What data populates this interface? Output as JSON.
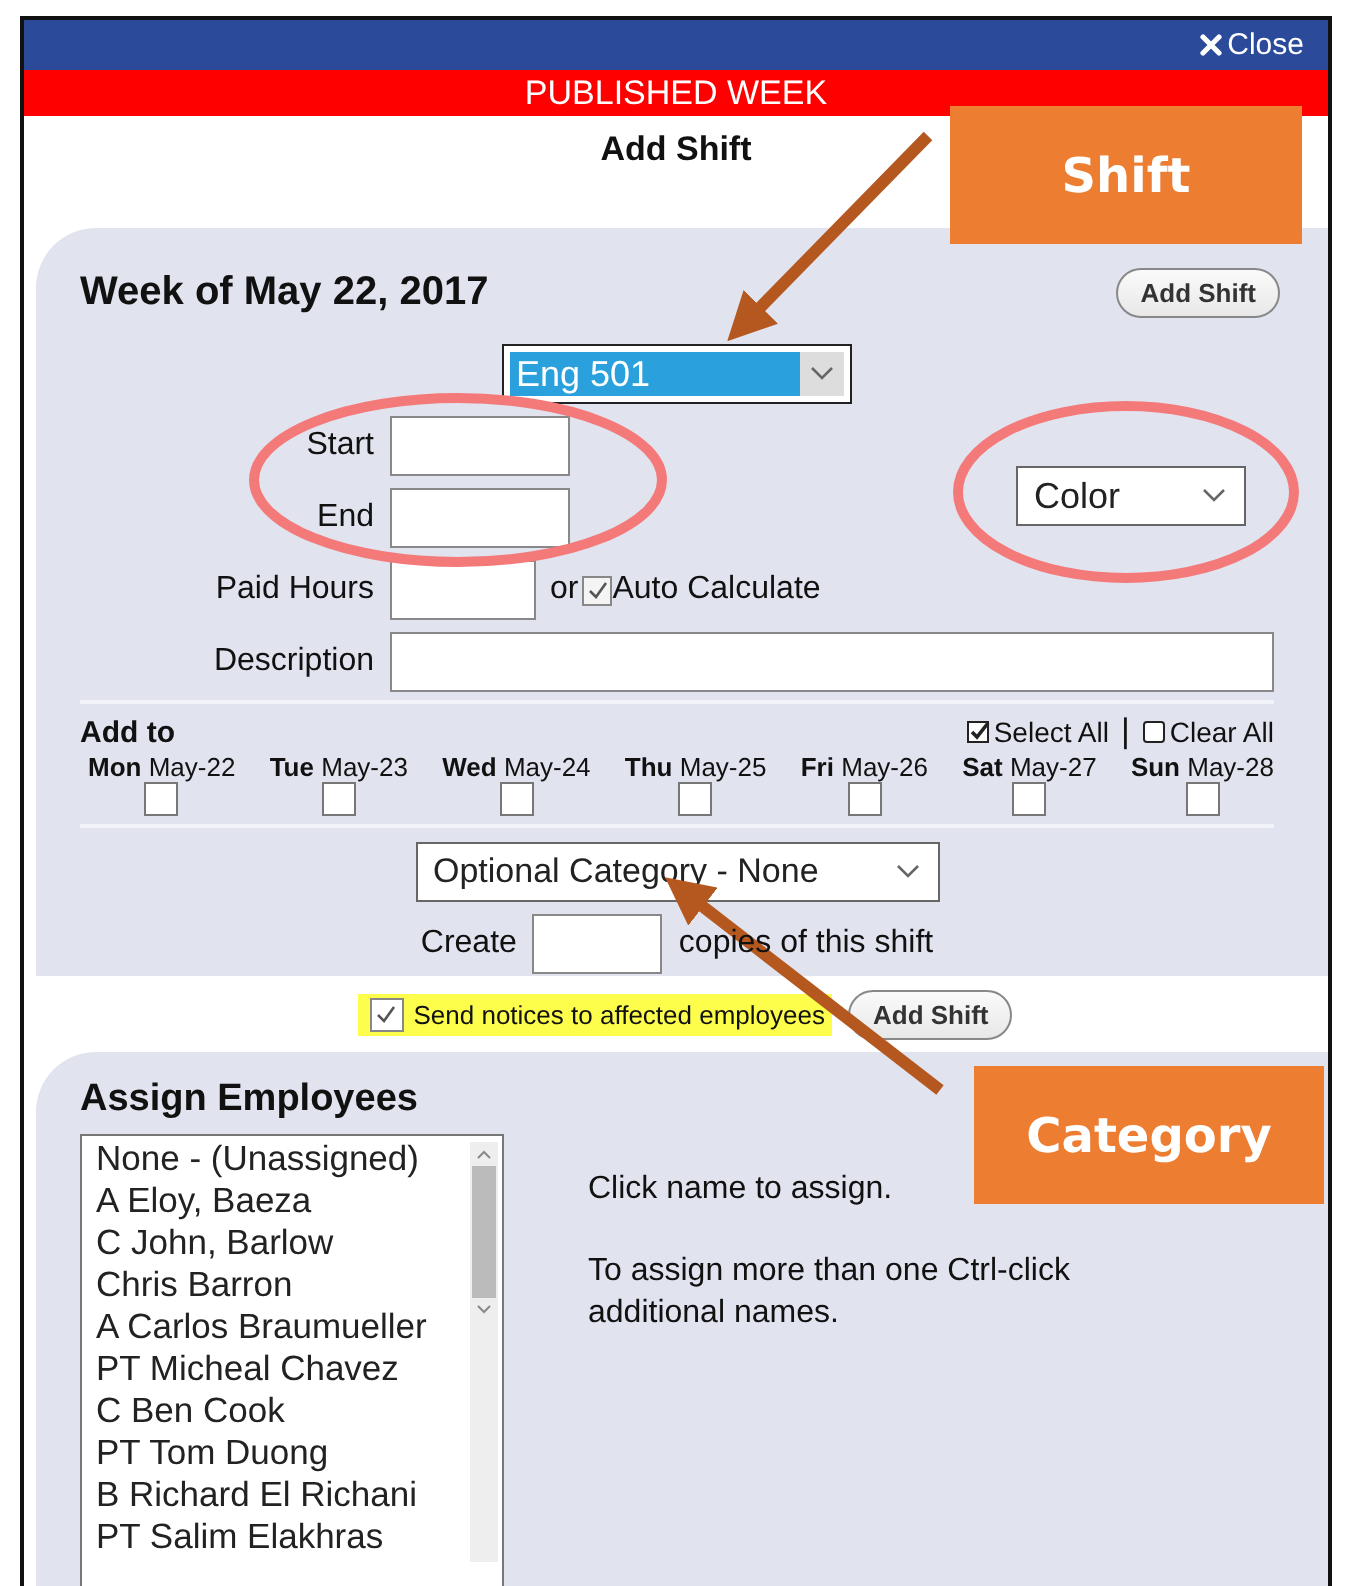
{
  "window": {
    "close": "Close",
    "banner": "PUBLISHED WEEK",
    "title": "Add Shift"
  },
  "shift_panel": {
    "heading": "Week of May 22, 2017",
    "add_button": "Add Shift",
    "shift_select": {
      "value": "Eng 501",
      "selected": true
    },
    "start": {
      "label": "Start"
    },
    "end": {
      "label": "End"
    },
    "color_select": {
      "value": "Color"
    },
    "paid_hours": {
      "label": "Paid Hours",
      "or": "or",
      "auto": {
        "label": "Auto Calculate",
        "checked": true
      }
    },
    "description": {
      "label": "Description"
    },
    "add_to": {
      "label": "Add to",
      "select_all": "Select All",
      "separator": "|",
      "clear_all": "Clear All",
      "days": [
        {
          "day": "Mon",
          "date": "May-22",
          "checked": false
        },
        {
          "day": "Tue",
          "date": "May-23",
          "checked": false
        },
        {
          "day": "Wed",
          "date": "May-24",
          "checked": false
        },
        {
          "day": "Thu",
          "date": "May-25",
          "checked": false
        },
        {
          "day": "Fri",
          "date": "May-26",
          "checked": false
        },
        {
          "day": "Sat",
          "date": "May-27",
          "checked": false
        },
        {
          "day": "Sun",
          "date": "May-28",
          "checked": false
        }
      ]
    },
    "category_select": {
      "value": "Optional Category - None"
    },
    "copies": {
      "before": "Create",
      "after": "copies of this shift"
    }
  },
  "notices": {
    "label": "Send notices to affected employees",
    "checked": true,
    "button": "Add Shift"
  },
  "assign_panel": {
    "heading": "Assign Employees",
    "employees": [
      {
        "name": "None - (Unassigned)",
        "selected": false
      },
      {
        "name": "A Eloy, Baeza",
        "selected": false
      },
      {
        "name": "C John, Barlow",
        "selected": false
      },
      {
        "name": "Chris Barron",
        "selected": false
      },
      {
        "name": "A Carlos Braumueller",
        "selected": false
      },
      {
        "name": "PT Micheal Chavez",
        "selected": false
      },
      {
        "name": "C Ben Cook",
        "selected": false
      },
      {
        "name": "PT Tom Duong",
        "selected": false
      },
      {
        "name": "B Richard El Richani",
        "selected": false
      },
      {
        "name": "PT Salim Elakhras",
        "selected": false
      }
    ],
    "hint": "Click name to assign.",
    "hint_more": "To assign more than one Ctrl-click additional names."
  },
  "annotations": [
    {
      "kind": "callout",
      "label": "Shift"
    },
    {
      "kind": "callout",
      "label": "Category"
    }
  ]
}
